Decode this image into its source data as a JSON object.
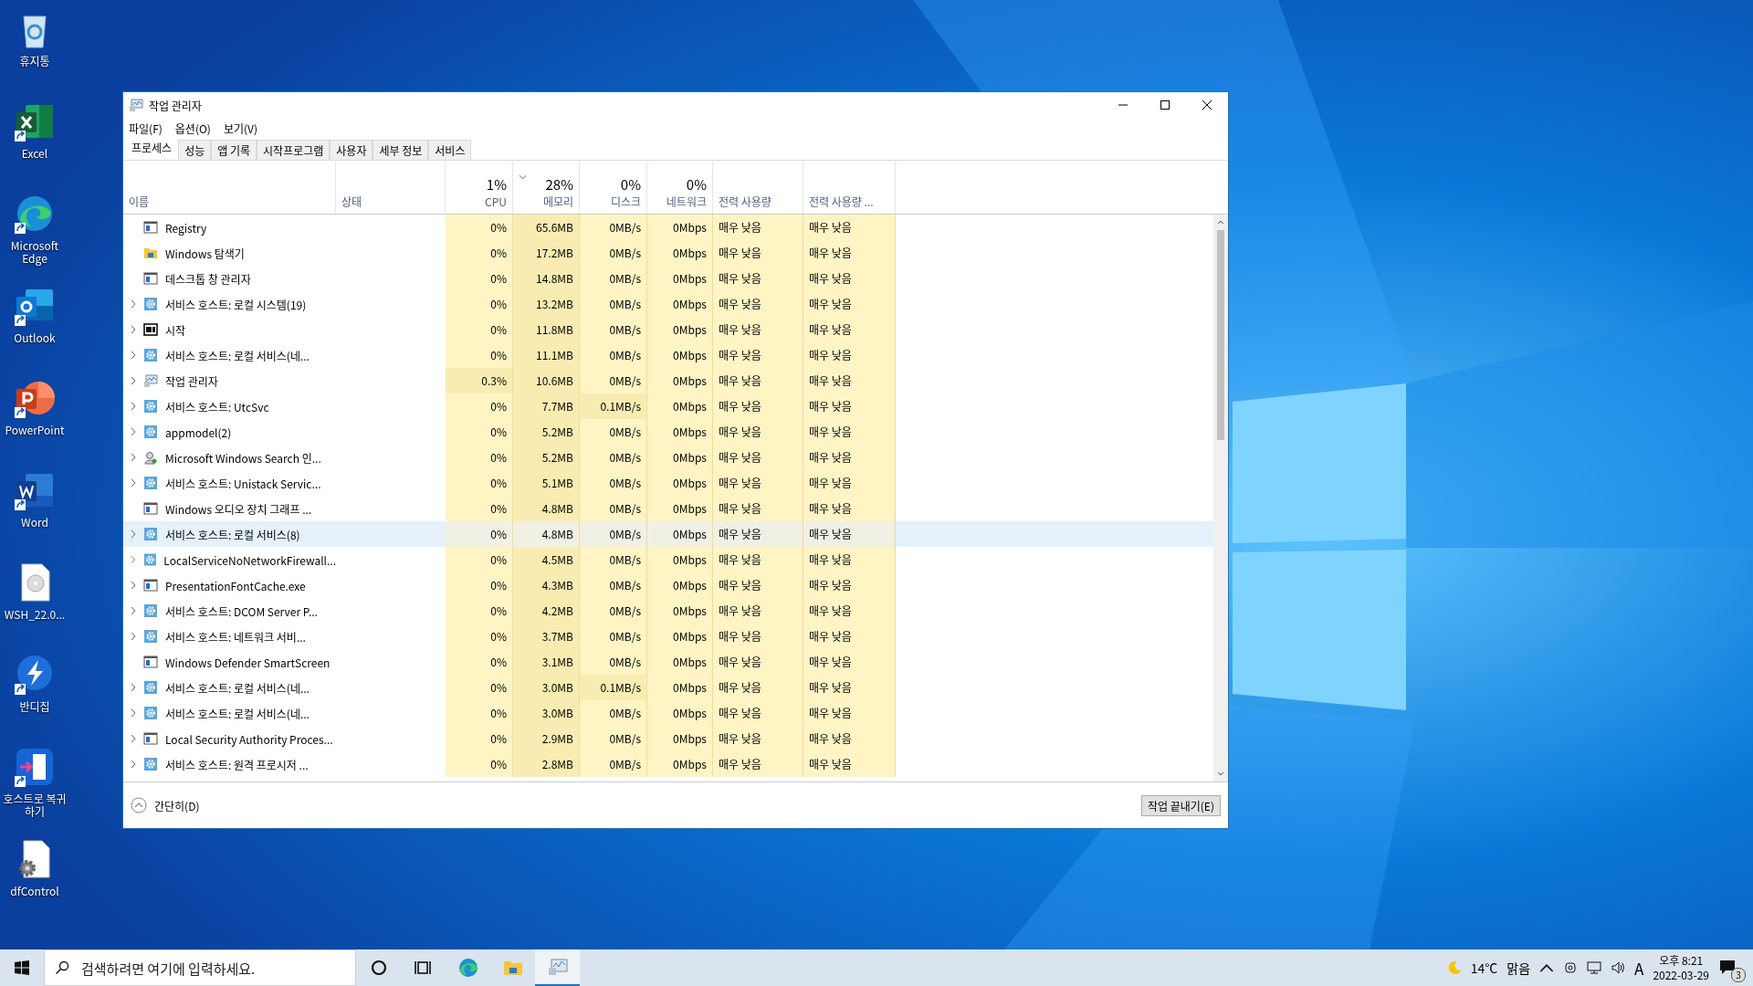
{
  "desktop_icons": [
    {
      "label": "휴지통",
      "shortcut": false
    },
    {
      "label": "Excel",
      "shortcut": true
    },
    {
      "label": "Microsoft Edge",
      "shortcut": true
    },
    {
      "label": "Outlook",
      "shortcut": true
    },
    {
      "label": "PowerPoint",
      "shortcut": true
    },
    {
      "label": "Word",
      "shortcut": true
    },
    {
      "label": "WSH_22.0...",
      "shortcut": false
    },
    {
      "label": "반디집",
      "shortcut": true
    },
    {
      "label": "호스트로 복귀하기",
      "shortcut": true
    },
    {
      "label": "dfControl",
      "shortcut": false
    }
  ],
  "window": {
    "title": "작업 관리자",
    "menu": [
      "파일(F)",
      "옵션(O)",
      "보기(V)"
    ],
    "tabs": [
      {
        "label": "프로세스",
        "selected": true
      },
      {
        "label": "성능",
        "selected": false
      },
      {
        "label": "앱 기록",
        "selected": false
      },
      {
        "label": "시작프로그램",
        "selected": false
      },
      {
        "label": "사용자",
        "selected": false
      },
      {
        "label": "세부 정보",
        "selected": false
      },
      {
        "label": "서비스",
        "selected": false
      }
    ],
    "columns": [
      {
        "label": "이름",
        "kind": "text"
      },
      {
        "label": "상태",
        "kind": "text"
      },
      {
        "label": "CPU",
        "total": "1%",
        "kind": "metric",
        "sorted": false
      },
      {
        "label": "메모리",
        "total": "28%",
        "kind": "metric",
        "sorted": true
      },
      {
        "label": "디스크",
        "total": "0%",
        "kind": "metric",
        "sorted": false
      },
      {
        "label": "네트워크",
        "total": "0%",
        "kind": "metric",
        "sorted": false
      },
      {
        "label": "전력 사용량",
        "kind": "text"
      },
      {
        "label": "전력 사용량 ...",
        "kind": "text"
      }
    ],
    "rows": [
      {
        "name": "Registry",
        "expandable": false,
        "selected": false,
        "cpu": "0%",
        "cpu_high": false,
        "memory": "65.6MB",
        "disk": "0MB/s",
        "disk_high": false,
        "network": "0Mbps",
        "power": "매우 낮음",
        "power_trend": "매우 낮음"
      },
      {
        "name": "Windows 탐색기",
        "expandable": false,
        "selected": false,
        "cpu": "0%",
        "cpu_high": false,
        "memory": "17.2MB",
        "disk": "0MB/s",
        "disk_high": false,
        "network": "0Mbps",
        "power": "매우 낮음",
        "power_trend": "매우 낮음"
      },
      {
        "name": "데스크톱 창 관리자",
        "expandable": false,
        "selected": false,
        "cpu": "0%",
        "cpu_high": false,
        "memory": "14.8MB",
        "disk": "0MB/s",
        "disk_high": false,
        "network": "0Mbps",
        "power": "매우 낮음",
        "power_trend": "매우 낮음"
      },
      {
        "name": "서비스 호스트: 로컬 시스템(19)",
        "expandable": true,
        "selected": false,
        "cpu": "0%",
        "cpu_high": false,
        "memory": "13.2MB",
        "disk": "0MB/s",
        "disk_high": false,
        "network": "0Mbps",
        "power": "매우 낮음",
        "power_trend": "매우 낮음"
      },
      {
        "name": "시작",
        "expandable": true,
        "selected": false,
        "cpu": "0%",
        "cpu_high": false,
        "memory": "11.8MB",
        "disk": "0MB/s",
        "disk_high": false,
        "network": "0Mbps",
        "power": "매우 낮음",
        "power_trend": "매우 낮음"
      },
      {
        "name": "서비스 호스트: 로컬 서비스(네...",
        "expandable": true,
        "selected": false,
        "cpu": "0%",
        "cpu_high": false,
        "memory": "11.1MB",
        "disk": "0MB/s",
        "disk_high": false,
        "network": "0Mbps",
        "power": "매우 낮음",
        "power_trend": "매우 낮음"
      },
      {
        "name": "작업 관리자",
        "expandable": true,
        "selected": false,
        "cpu": "0.3%",
        "cpu_high": true,
        "memory": "10.6MB",
        "disk": "0MB/s",
        "disk_high": false,
        "network": "0Mbps",
        "power": "매우 낮음",
        "power_trend": "매우 낮음"
      },
      {
        "name": "서비스 호스트: UtcSvc",
        "expandable": true,
        "selected": false,
        "cpu": "0%",
        "cpu_high": false,
        "memory": "7.7MB",
        "disk": "0.1MB/s",
        "disk_high": true,
        "network": "0Mbps",
        "power": "매우 낮음",
        "power_trend": "매우 낮음"
      },
      {
        "name": "appmodel(2)",
        "expandable": true,
        "selected": false,
        "cpu": "0%",
        "cpu_high": false,
        "memory": "5.2MB",
        "disk": "0MB/s",
        "disk_high": false,
        "network": "0Mbps",
        "power": "매우 낮음",
        "power_trend": "매우 낮음"
      },
      {
        "name": "Microsoft Windows Search 인...",
        "expandable": true,
        "selected": false,
        "cpu": "0%",
        "cpu_high": false,
        "memory": "5.2MB",
        "disk": "0MB/s",
        "disk_high": false,
        "network": "0Mbps",
        "power": "매우 낮음",
        "power_trend": "매우 낮음"
      },
      {
        "name": "서비스 호스트: Unistack Servic...",
        "expandable": true,
        "selected": false,
        "cpu": "0%",
        "cpu_high": false,
        "memory": "5.1MB",
        "disk": "0MB/s",
        "disk_high": false,
        "network": "0Mbps",
        "power": "매우 낮음",
        "power_trend": "매우 낮음"
      },
      {
        "name": "Windows 오디오 장치 그래프 ...",
        "expandable": false,
        "selected": false,
        "cpu": "0%",
        "cpu_high": false,
        "memory": "4.8MB",
        "disk": "0MB/s",
        "disk_high": false,
        "network": "0Mbps",
        "power": "매우 낮음",
        "power_trend": "매우 낮음"
      },
      {
        "name": "서비스 호스트: 로컬 서비스(8)",
        "expandable": true,
        "selected": true,
        "cpu": "0%",
        "cpu_high": false,
        "memory": "4.8MB",
        "disk": "0MB/s",
        "disk_high": false,
        "network": "0Mbps",
        "power": "매우 낮음",
        "power_trend": "매우 낮음"
      },
      {
        "name": "LocalServiceNoNetworkFirewall...",
        "expandable": true,
        "selected": false,
        "cpu": "0%",
        "cpu_high": false,
        "memory": "4.5MB",
        "disk": "0MB/s",
        "disk_high": false,
        "network": "0Mbps",
        "power": "매우 낮음",
        "power_trend": "매우 낮음"
      },
      {
        "name": "PresentationFontCache.exe",
        "expandable": true,
        "selected": false,
        "cpu": "0%",
        "cpu_high": false,
        "memory": "4.3MB",
        "disk": "0MB/s",
        "disk_high": false,
        "network": "0Mbps",
        "power": "매우 낮음",
        "power_trend": "매우 낮음"
      },
      {
        "name": "서비스 호스트: DCOM Server P...",
        "expandable": true,
        "selected": false,
        "cpu": "0%",
        "cpu_high": false,
        "memory": "4.2MB",
        "disk": "0MB/s",
        "disk_high": false,
        "network": "0Mbps",
        "power": "매우 낮음",
        "power_trend": "매우 낮음"
      },
      {
        "name": "서비스 호스트: 네트워크 서비...",
        "expandable": true,
        "selected": false,
        "cpu": "0%",
        "cpu_high": false,
        "memory": "3.7MB",
        "disk": "0MB/s",
        "disk_high": false,
        "network": "0Mbps",
        "power": "매우 낮음",
        "power_trend": "매우 낮음"
      },
      {
        "name": "Windows Defender SmartScreen",
        "expandable": false,
        "selected": false,
        "cpu": "0%",
        "cpu_high": false,
        "memory": "3.1MB",
        "disk": "0MB/s",
        "disk_high": false,
        "network": "0Mbps",
        "power": "매우 낮음",
        "power_trend": "매우 낮음"
      },
      {
        "name": "서비스 호스트: 로컬 서비스(네...",
        "expandable": true,
        "selected": false,
        "cpu": "0%",
        "cpu_high": false,
        "memory": "3.0MB",
        "disk": "0.1MB/s",
        "disk_high": true,
        "network": "0Mbps",
        "power": "매우 낮음",
        "power_trend": "매우 낮음"
      },
      {
        "name": "서비스 호스트: 로컬 서비스(네...",
        "expandable": true,
        "selected": false,
        "cpu": "0%",
        "cpu_high": false,
        "memory": "3.0MB",
        "disk": "0MB/s",
        "disk_high": false,
        "network": "0Mbps",
        "power": "매우 낮음",
        "power_trend": "매우 낮음"
      },
      {
        "name": "Local Security Authority Proces...",
        "expandable": true,
        "selected": false,
        "cpu": "0%",
        "cpu_high": false,
        "memory": "2.9MB",
        "disk": "0MB/s",
        "disk_high": false,
        "network": "0Mbps",
        "power": "매우 낮음",
        "power_trend": "매우 낮음"
      },
      {
        "name": "서비스 호스트: 원격 프로시저 ...",
        "expandable": true,
        "selected": false,
        "cpu": "0%",
        "cpu_high": false,
        "memory": "2.8MB",
        "disk": "0MB/s",
        "disk_high": false,
        "network": "0Mbps",
        "power": "매우 낮음",
        "power_trend": "매우 낮음"
      }
    ],
    "footer": {
      "collapse": "간단히(D)",
      "end_task": "작업 끝내기(E)"
    }
  },
  "taskbar": {
    "search": {
      "placeholder": "검색하려면 여기에 입력하세요."
    },
    "apps": [
      {
        "active": false
      },
      {
        "active": false
      },
      {
        "active": false
      },
      {
        "active": false
      },
      {
        "active": true
      }
    ],
    "weather": {
      "temperature": "14°C",
      "condition": "맑음"
    },
    "input_mode": "A",
    "time": "오후 8:21",
    "date": "2022-03-29",
    "notifications": "3"
  }
}
